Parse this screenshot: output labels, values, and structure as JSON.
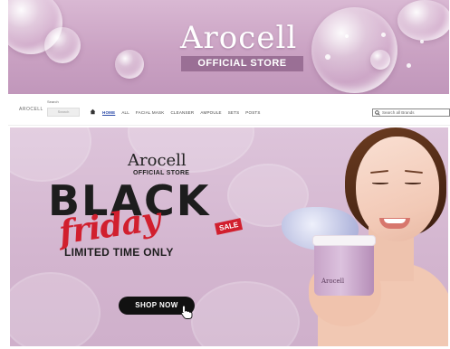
{
  "header": {
    "brand": "Arocell",
    "store_label": "OFFICIAL STORE"
  },
  "nav": {
    "logo": "AROCELL",
    "search_label": "Search",
    "search_value": "Search",
    "menu": [
      "HOME",
      "ALL",
      "FACIAL MASK",
      "CLEANSER",
      "AMPOULE",
      "SETS",
      "POSTS"
    ],
    "active": "HOME",
    "store_search_placeholder": "Search all Brands"
  },
  "promo": {
    "brand": "Arocell",
    "store_label": "OFFICIAL STORE",
    "headline_1": "BLACK",
    "headline_2": "friday",
    "sale_tag": "SALE",
    "subline": "LIMITED TIME ONLY",
    "cta": "SHOP NOW",
    "product_label": "Arocell"
  },
  "colors": {
    "banner_pink": "#caa2c3",
    "store_bar": "#9a6f95",
    "nav_active": "#2b4aa8",
    "friday_red": "#d11f2e",
    "cta_black": "#111111"
  }
}
